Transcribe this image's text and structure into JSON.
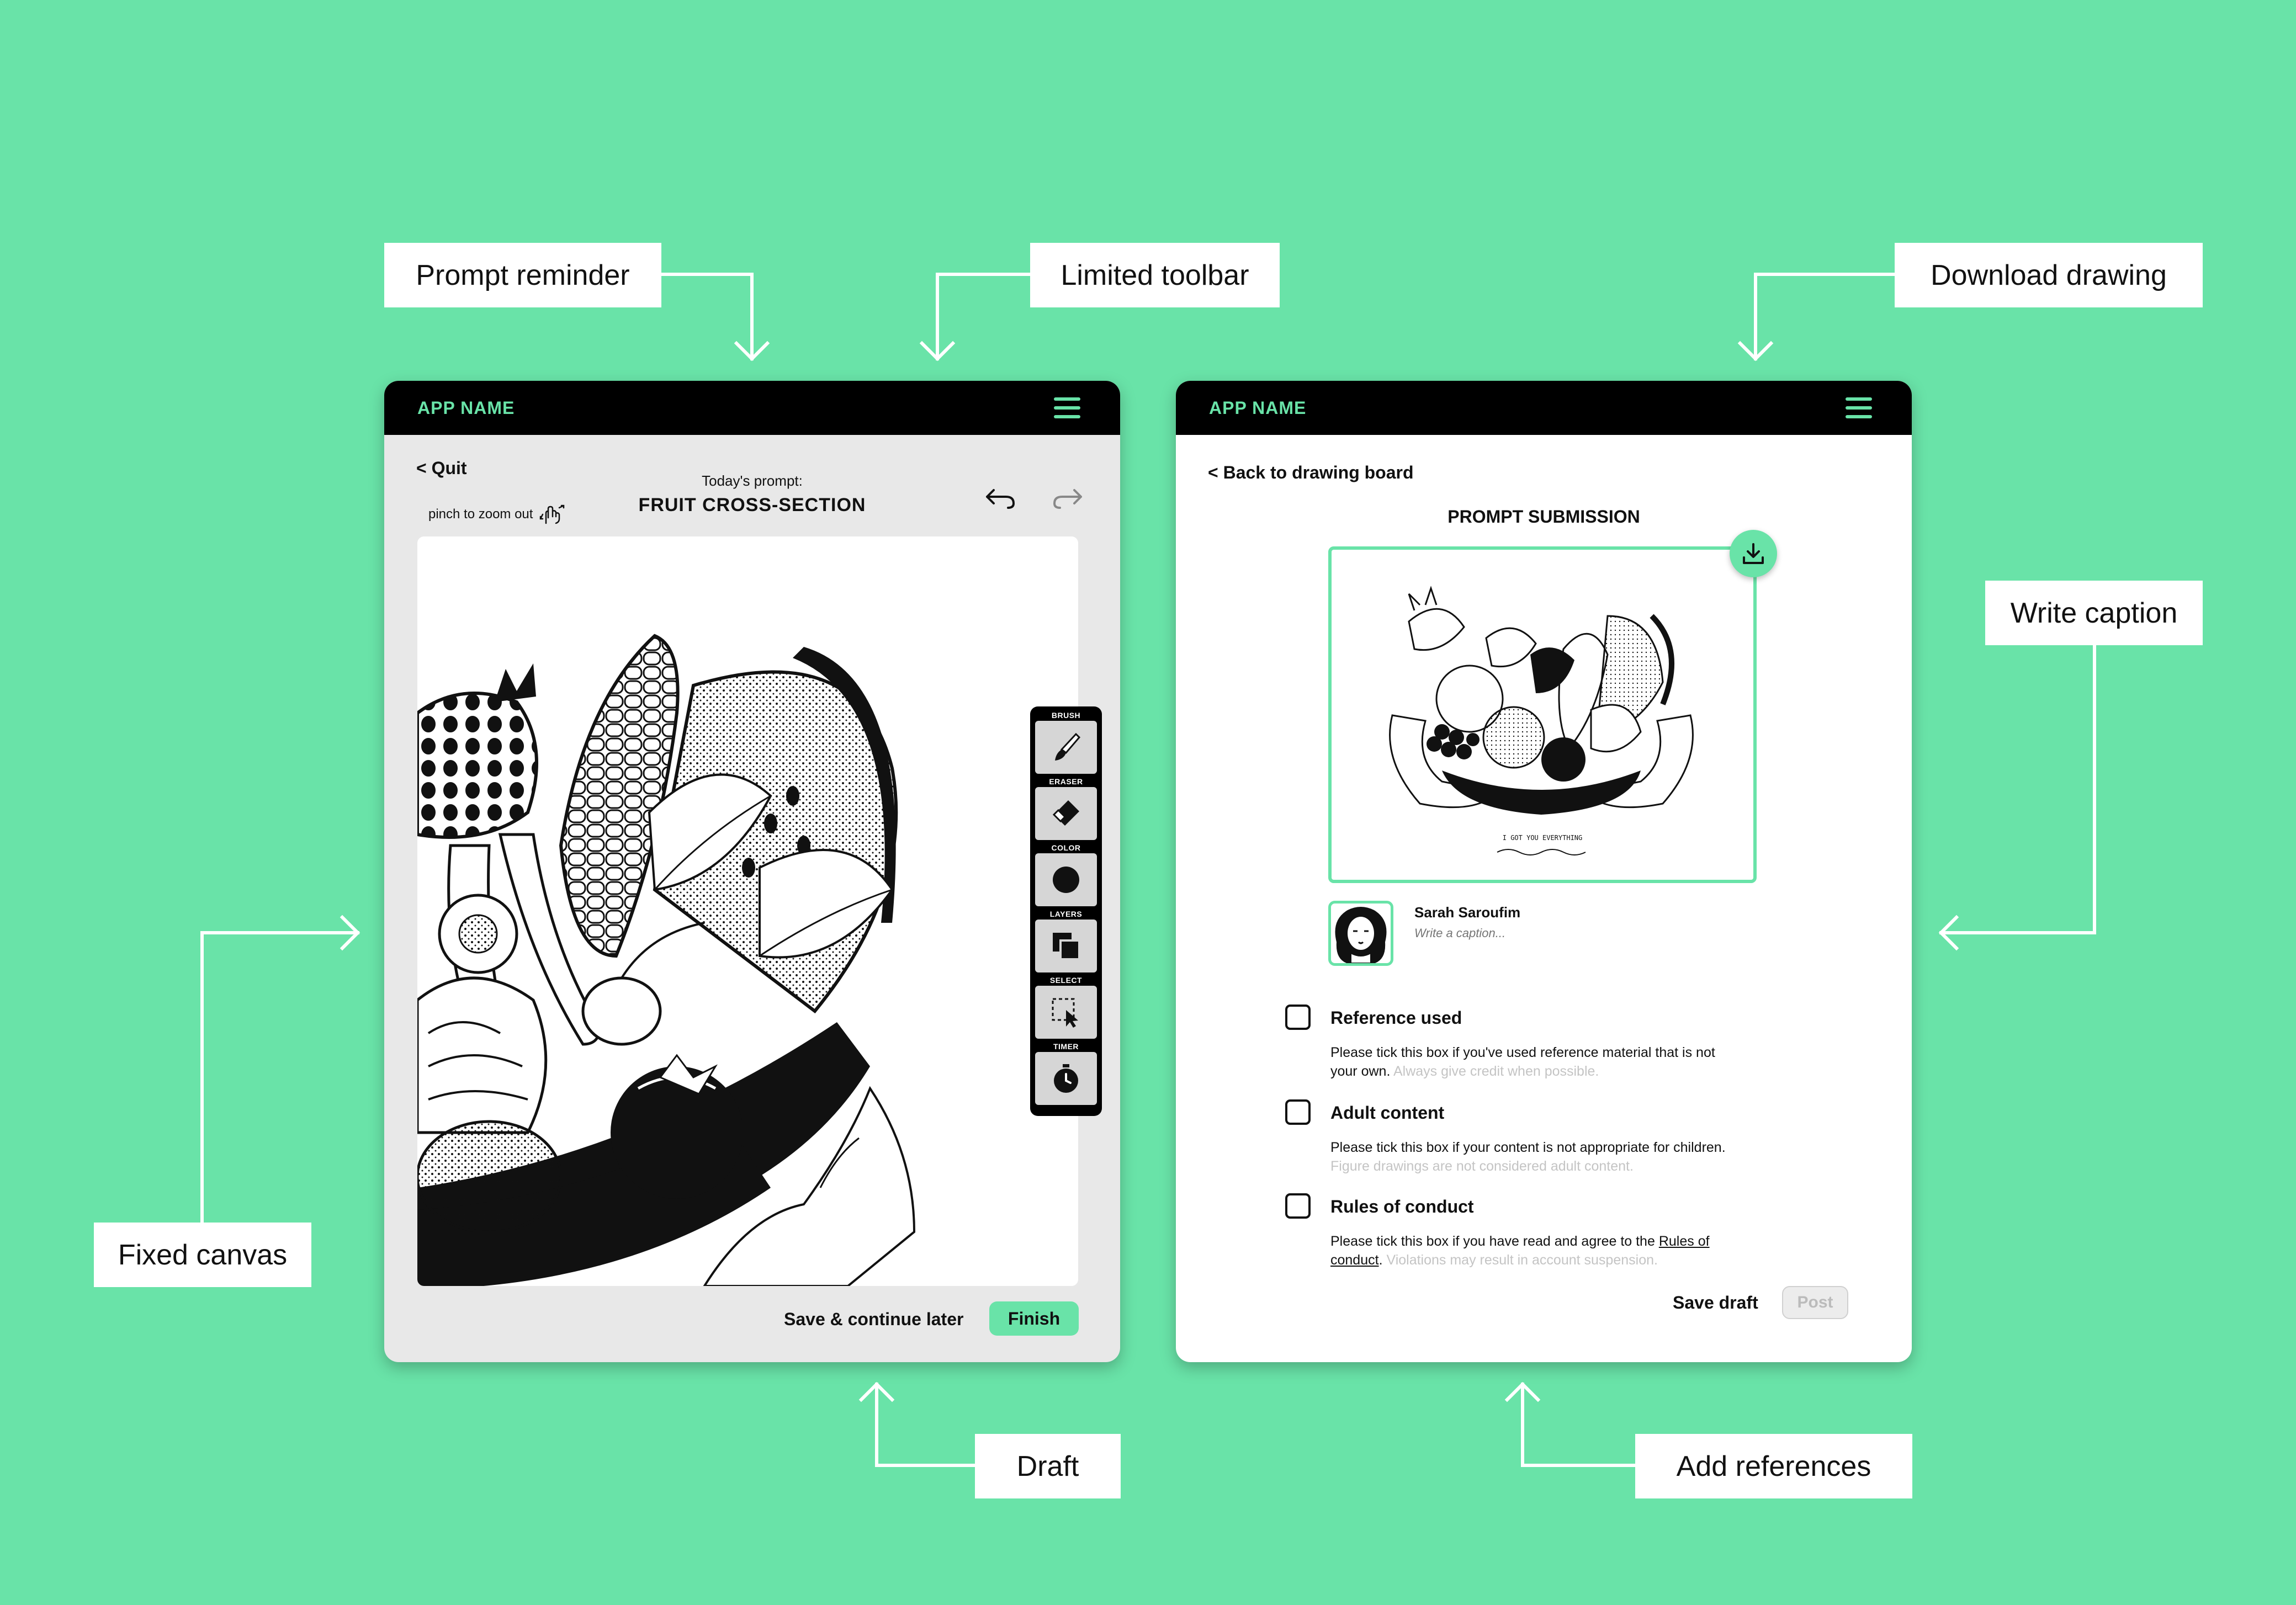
{
  "callouts": {
    "prompt_reminder": "Prompt reminder",
    "limited_toolbar": "Limited toolbar",
    "download_drawing": "Download drawing",
    "write_caption": "Write caption",
    "fixed_canvas": "Fixed canvas",
    "draft": "Draft",
    "add_references": "Add references"
  },
  "drawing_screen": {
    "app_name": "APP NAME",
    "quit_label": "< Quit",
    "pinch_hint": "pinch to zoom out",
    "prompt_label": "Today's prompt:",
    "prompt_title": "FRUIT CROSS-SECTION",
    "toolbar": [
      {
        "label": "BRUSH",
        "icon": "brush-icon"
      },
      {
        "label": "ERASER",
        "icon": "eraser-icon"
      },
      {
        "label": "COLOR",
        "icon": "color-icon"
      },
      {
        "label": "LAYERS",
        "icon": "layers-icon"
      },
      {
        "label": "SELECT",
        "icon": "select-icon"
      },
      {
        "label": "TIMER",
        "icon": "timer-icon"
      }
    ],
    "save_later_label": "Save & continue later",
    "finish_label": "Finish"
  },
  "submission_screen": {
    "app_name": "APP NAME",
    "back_label": "< Back to drawing board",
    "title": "PROMPT SUBMISSION",
    "artwork_text": "I GOT YOU EVERYTHING",
    "author_name": "Sarah Saroufim",
    "caption_placeholder": "Write a caption...",
    "checks": [
      {
        "title": "Reference used",
        "desc": "Please tick this box if you've used reference material that is not your own.",
        "note": "Always give credit when possible."
      },
      {
        "title": "Adult content",
        "desc": "Please tick this box if your content is not appropriate for children.",
        "note": "Figure drawings are not considered adult content."
      },
      {
        "title": "Rules of conduct",
        "desc_before": "Please tick this box if you have read and agree to the",
        "link": "Rules of conduct",
        "desc_after": ".",
        "note": "Violations may result in account suspension."
      }
    ],
    "save_draft_label": "Save draft",
    "post_label": "Post"
  },
  "colors": {
    "background": "#69E3A8",
    "accent": "#69E3A8",
    "appbar": "#000000"
  }
}
